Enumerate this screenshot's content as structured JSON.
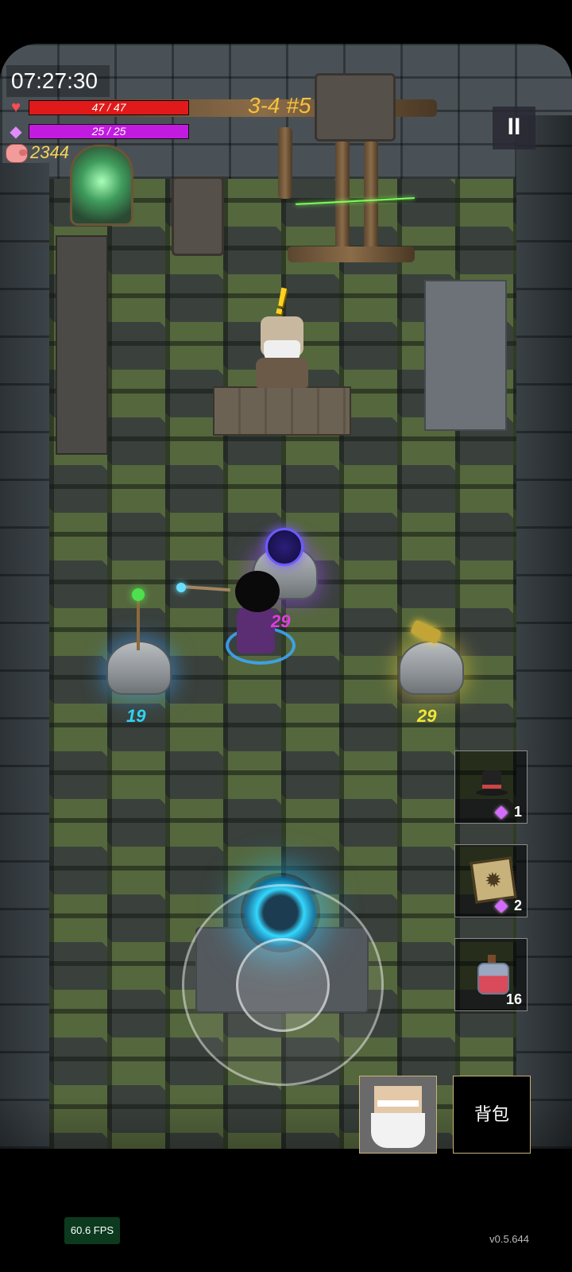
{
  "hud": {
    "clock": "07:27:30",
    "hp_text": "47 / 47",
    "hp_fraction": 1.0,
    "mp_text": "25 / 25",
    "mp_fraction": 1.0,
    "coins": "2344",
    "stage": "3-4 #5",
    "pause_label": "II",
    "hp_color": "#e01a1a",
    "mp_color": "#c21be0"
  },
  "floating_numbers": {
    "left": "19",
    "center": "29",
    "right": "29",
    "left_color": "#2fd3f3",
    "center_color": "#e13ce3",
    "right_color": "#f2e43a"
  },
  "inventory": {
    "hat_qty": "1",
    "cube_qty": "2",
    "potion_qty": "16"
  },
  "buttons": {
    "bag_label": "背包"
  },
  "footer": {
    "fps": "60.6 FPS",
    "version": "v0.5.644"
  }
}
